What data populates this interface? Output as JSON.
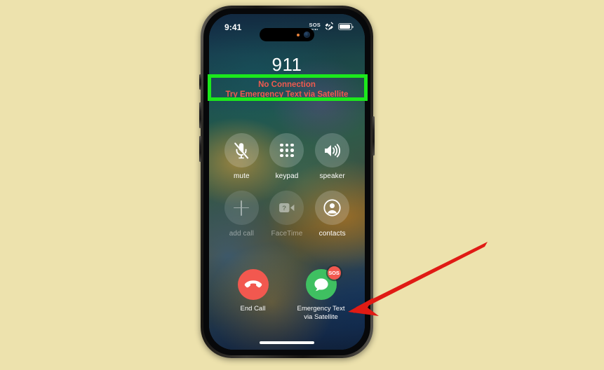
{
  "background_color": "#ede2ad",
  "device": {
    "name": "iphone-14-pro",
    "status_bar": {
      "time": "9:41",
      "sos_label": "SOS",
      "satellite_icon": "satellite-icon",
      "battery_icon": "battery-icon"
    },
    "dynamic_island": {
      "indicator_dot": "orange-recording-dot",
      "camera": "front-camera-lens"
    }
  },
  "call": {
    "number": "911",
    "status_lines": [
      "No Connection",
      "Try Emergency Text via Satellite"
    ],
    "status_color": "#f05a4f"
  },
  "controls": [
    {
      "id": "mute",
      "label": "mute",
      "icon": "mic-slash-icon",
      "disabled": false
    },
    {
      "id": "keypad",
      "label": "keypad",
      "icon": "keypad-dots-icon",
      "disabled": false
    },
    {
      "id": "speaker",
      "label": "speaker",
      "icon": "speaker-wave-icon",
      "disabled": false
    },
    {
      "id": "add-call",
      "label": "add call",
      "icon": "plus-icon",
      "disabled": true
    },
    {
      "id": "facetime",
      "label": "FaceTime",
      "icon": "video-camera-icon",
      "disabled": true
    },
    {
      "id": "contacts",
      "label": "contacts",
      "icon": "person-circle-icon",
      "disabled": false
    }
  ],
  "bottom_actions": {
    "end_call": {
      "label": "End Call",
      "icon": "phone-down-icon",
      "color": "#f2584f"
    },
    "emergency_text": {
      "label_line_1": "Emergency Text",
      "label_line_2": "via Satellite",
      "icon": "message-bubble-icon",
      "badge_label": "SOS",
      "color": "#3fc061",
      "badge_color": "#f2584f"
    }
  },
  "annotations": {
    "highlight_box": {
      "name": "green-highlight-box",
      "color": "#1ce81c",
      "targets": "call status text"
    },
    "arrow": {
      "name": "red-pointer-arrow",
      "color": "#e01b14",
      "points_to": "Emergency Text via Satellite button"
    }
  }
}
